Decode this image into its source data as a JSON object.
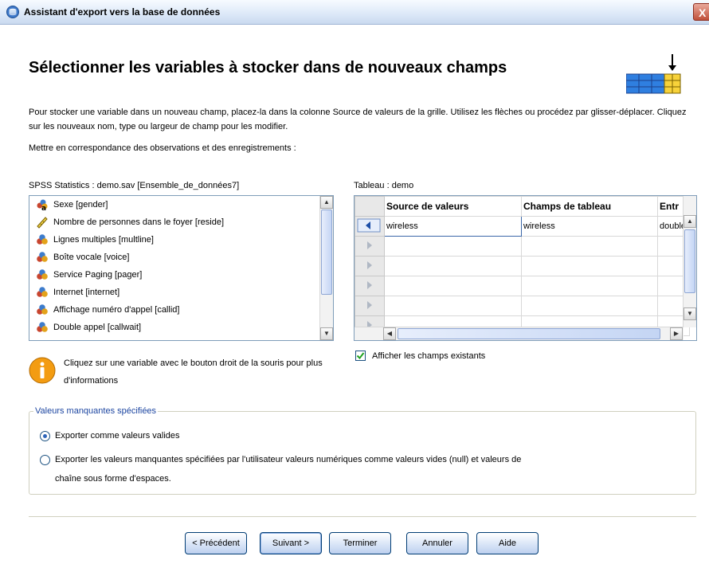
{
  "window": {
    "title": "Assistant d'export vers la base de données",
    "close_glyph": "X"
  },
  "header": {
    "title": "Sélectionner les variables à stocker dans de nouveaux champs",
    "icon": "table-export-icon",
    "instructions": "Pour stocker une variable dans un nouveau champ, placez-la dans la colonne Source de valeurs de la grille. Utilisez les flèches ou procédez par glisser-déplacer. Cliquez sur les nouveaux nom, type ou largeur de champ pour les modifier.",
    "match_label": "Mettre en correspondance des observations et des enregistrements :"
  },
  "source": {
    "label": "SPSS Statistics :  demo.sav [Ensemble_de_données7]",
    "items": [
      {
        "label": "Sexe [gender]",
        "icon": "nominal-string-icon"
      },
      {
        "label": "Nombre de personnes dans le foyer [reside]",
        "icon": "scale-ruler-icon"
      },
      {
        "label": "Lignes multiples [multline]",
        "icon": "nominal-icon"
      },
      {
        "label": "Boîte vocale [voice]",
        "icon": "nominal-icon"
      },
      {
        "label": "Service Paging [pager]",
        "icon": "nominal-icon"
      },
      {
        "label": "Internet [internet]",
        "icon": "nominal-icon"
      },
      {
        "label": "Affichage numéro d'appel [callid]",
        "icon": "nominal-icon"
      },
      {
        "label": "Double appel [callwait]",
        "icon": "nominal-icon"
      }
    ],
    "info": "Cliquez sur une variable avec le bouton droit de la souris pour plus d'informations"
  },
  "table": {
    "label": "Tableau :  demo",
    "columns": [
      "Source de valeurs",
      "Champs de tableau",
      "Entr"
    ],
    "rows": [
      [
        "wireless",
        "wireless",
        "double"
      ],
      [
        "",
        "",
        ""
      ],
      [
        "",
        "",
        ""
      ],
      [
        "",
        "",
        ""
      ],
      [
        "",
        "",
        ""
      ],
      [
        "",
        "",
        ""
      ]
    ],
    "show_existing_label": "Afficher les champs existants",
    "show_existing_checked": true
  },
  "missing": {
    "legend": "Valeurs manquantes spécifiées",
    "option1": "Exporter comme valeurs valides",
    "option2_line1": "Exporter les valeurs manquantes spécifiées par l'utilisateur valeurs numériques comme valeurs vides (null) et valeurs de",
    "option2_line2": "chaîne sous forme d'espaces.",
    "selected": 1
  },
  "buttons": {
    "back": "< Précédent",
    "next": "Suivant >",
    "finish": "Terminer",
    "cancel": "Annuler",
    "help": "Aide"
  },
  "colors": {
    "accent": "#2d64b8",
    "window_bg": "#ffffff",
    "legend": "#1d46a1"
  }
}
